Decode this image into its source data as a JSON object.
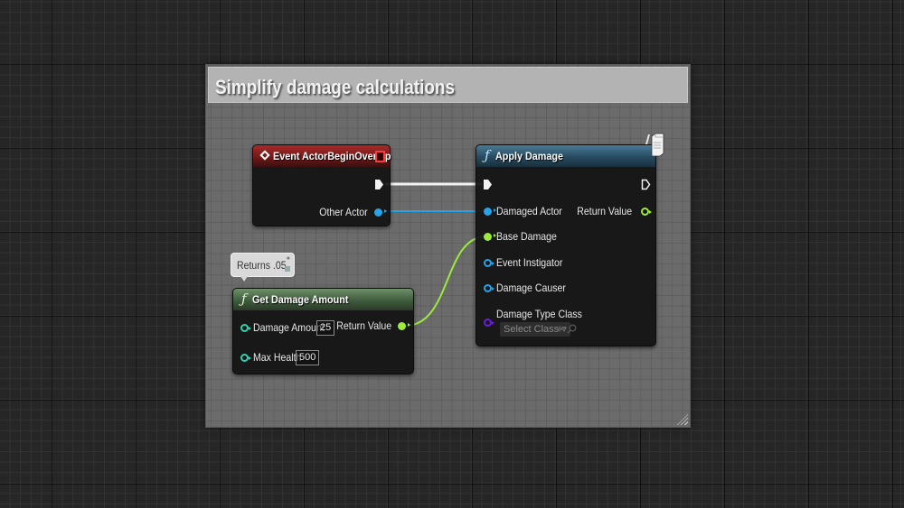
{
  "comment_box": {
    "title": "Simplify damage calculations"
  },
  "colors": {
    "exec_wire": "#f2f2f2",
    "object_wire": "#2aa2e6",
    "float_wire": "#9bea3c",
    "event_header": "#8b1f1f",
    "function_header_blue": "#2f5a73",
    "function_header_green": "#4a6a47"
  },
  "nodes": {
    "event_begin_overlap": {
      "title": "Event ActorBeginOverlap",
      "icon": "event-diamond-icon",
      "outputs": [
        {
          "label": "",
          "type": "exec"
        },
        {
          "label": "Other Actor",
          "type": "object"
        }
      ]
    },
    "apply_damage": {
      "title": "Apply Damage",
      "icon": "function-icon",
      "inputs": [
        {
          "label": "",
          "type": "exec"
        },
        {
          "label": "Damaged Actor",
          "type": "object"
        },
        {
          "label": "Base Damage",
          "type": "float"
        },
        {
          "label": "Event Instigator",
          "type": "object"
        },
        {
          "label": "Damage Causer",
          "type": "object"
        },
        {
          "label": "Damage Type Class",
          "type": "class",
          "select_placeholder": "Select Class ▾"
        }
      ],
      "outputs": [
        {
          "label": "",
          "type": "exec"
        },
        {
          "label": "Return Value",
          "type": "float"
        }
      ]
    },
    "get_damage_amount": {
      "title": "Get Damage Amount",
      "icon": "function-icon",
      "comment_bubble": "Returns .05",
      "inputs": [
        {
          "label": "Damage Amount",
          "type": "int",
          "value": "25"
        },
        {
          "label": "Max Health",
          "type": "int",
          "value": "500"
        }
      ],
      "outputs": [
        {
          "label": "Return Value",
          "type": "float"
        }
      ]
    }
  }
}
